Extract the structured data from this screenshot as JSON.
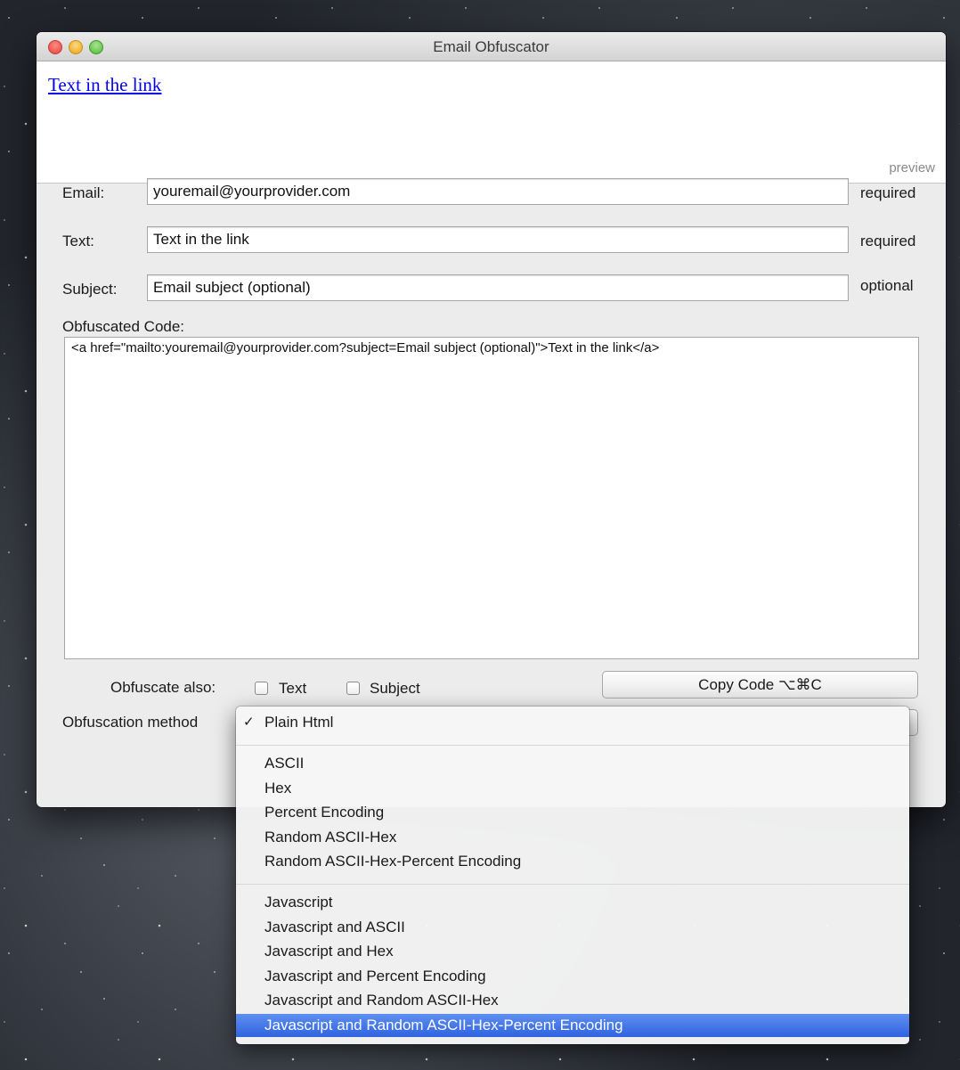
{
  "window": {
    "title": "Email Obfuscator"
  },
  "preview": {
    "link_text": "Text in the link",
    "label": "preview"
  },
  "form": {
    "email": {
      "label": "Email:",
      "value": "youremail@yourprovider.com",
      "hint": "required"
    },
    "text": {
      "label": "Text:",
      "value": "Text in the link",
      "hint": "required"
    },
    "subject": {
      "label": "Subject:",
      "value": "Email subject (optional)",
      "hint": "optional"
    },
    "code_label": "Obfuscated Code:",
    "code": "<a href=\"mailto:youremail@yourprovider.com?subject=Email subject (optional)\">Text in the link</a>",
    "obfuscate_also_label": "Obfuscate also:",
    "obfuscate_text_label": "Text",
    "obfuscate_subject_label": "Subject",
    "copy_button": "Copy Code  ⌥⌘C",
    "method_label": "Obfuscation method"
  },
  "menu": {
    "checkmark": "✓",
    "items": [
      "Plain Html",
      "ASCII",
      "Hex",
      "Percent Encoding",
      "Random ASCII-Hex",
      "Random ASCII-Hex-Percent Encoding",
      "Javascript",
      "Javascript and ASCII",
      "Javascript and Hex",
      "Javascript and Percent Encoding",
      "Javascript and Random ASCII-Hex",
      "Javascript and Random ASCII-Hex-Percent Encoding"
    ],
    "checked_item": "Plain Html",
    "highlighted_item": "Javascript and Random ASCII-Hex-Percent Encoding"
  },
  "colors": {
    "link": "#0000ee",
    "menu_highlight": "#3a6ee6"
  }
}
